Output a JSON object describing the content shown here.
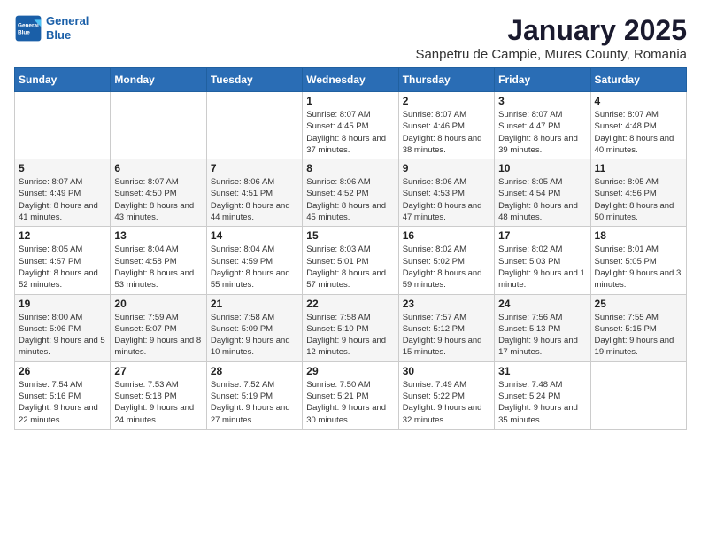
{
  "header": {
    "logo_line1": "General",
    "logo_line2": "Blue",
    "month": "January 2025",
    "location": "Sanpetru de Campie, Mures County, Romania"
  },
  "days_of_week": [
    "Sunday",
    "Monday",
    "Tuesday",
    "Wednesday",
    "Thursday",
    "Friday",
    "Saturday"
  ],
  "weeks": [
    [
      {
        "day": "",
        "info": ""
      },
      {
        "day": "",
        "info": ""
      },
      {
        "day": "",
        "info": ""
      },
      {
        "day": "1",
        "info": "Sunrise: 8:07 AM\nSunset: 4:45 PM\nDaylight: 8 hours and 37 minutes."
      },
      {
        "day": "2",
        "info": "Sunrise: 8:07 AM\nSunset: 4:46 PM\nDaylight: 8 hours and 38 minutes."
      },
      {
        "day": "3",
        "info": "Sunrise: 8:07 AM\nSunset: 4:47 PM\nDaylight: 8 hours and 39 minutes."
      },
      {
        "day": "4",
        "info": "Sunrise: 8:07 AM\nSunset: 4:48 PM\nDaylight: 8 hours and 40 minutes."
      }
    ],
    [
      {
        "day": "5",
        "info": "Sunrise: 8:07 AM\nSunset: 4:49 PM\nDaylight: 8 hours and 41 minutes."
      },
      {
        "day": "6",
        "info": "Sunrise: 8:07 AM\nSunset: 4:50 PM\nDaylight: 8 hours and 43 minutes."
      },
      {
        "day": "7",
        "info": "Sunrise: 8:06 AM\nSunset: 4:51 PM\nDaylight: 8 hours and 44 minutes."
      },
      {
        "day": "8",
        "info": "Sunrise: 8:06 AM\nSunset: 4:52 PM\nDaylight: 8 hours and 45 minutes."
      },
      {
        "day": "9",
        "info": "Sunrise: 8:06 AM\nSunset: 4:53 PM\nDaylight: 8 hours and 47 minutes."
      },
      {
        "day": "10",
        "info": "Sunrise: 8:05 AM\nSunset: 4:54 PM\nDaylight: 8 hours and 48 minutes."
      },
      {
        "day": "11",
        "info": "Sunrise: 8:05 AM\nSunset: 4:56 PM\nDaylight: 8 hours and 50 minutes."
      }
    ],
    [
      {
        "day": "12",
        "info": "Sunrise: 8:05 AM\nSunset: 4:57 PM\nDaylight: 8 hours and 52 minutes."
      },
      {
        "day": "13",
        "info": "Sunrise: 8:04 AM\nSunset: 4:58 PM\nDaylight: 8 hours and 53 minutes."
      },
      {
        "day": "14",
        "info": "Sunrise: 8:04 AM\nSunset: 4:59 PM\nDaylight: 8 hours and 55 minutes."
      },
      {
        "day": "15",
        "info": "Sunrise: 8:03 AM\nSunset: 5:01 PM\nDaylight: 8 hours and 57 minutes."
      },
      {
        "day": "16",
        "info": "Sunrise: 8:02 AM\nSunset: 5:02 PM\nDaylight: 8 hours and 59 minutes."
      },
      {
        "day": "17",
        "info": "Sunrise: 8:02 AM\nSunset: 5:03 PM\nDaylight: 9 hours and 1 minute."
      },
      {
        "day": "18",
        "info": "Sunrise: 8:01 AM\nSunset: 5:05 PM\nDaylight: 9 hours and 3 minutes."
      }
    ],
    [
      {
        "day": "19",
        "info": "Sunrise: 8:00 AM\nSunset: 5:06 PM\nDaylight: 9 hours and 5 minutes."
      },
      {
        "day": "20",
        "info": "Sunrise: 7:59 AM\nSunset: 5:07 PM\nDaylight: 9 hours and 8 minutes."
      },
      {
        "day": "21",
        "info": "Sunrise: 7:58 AM\nSunset: 5:09 PM\nDaylight: 9 hours and 10 minutes."
      },
      {
        "day": "22",
        "info": "Sunrise: 7:58 AM\nSunset: 5:10 PM\nDaylight: 9 hours and 12 minutes."
      },
      {
        "day": "23",
        "info": "Sunrise: 7:57 AM\nSunset: 5:12 PM\nDaylight: 9 hours and 15 minutes."
      },
      {
        "day": "24",
        "info": "Sunrise: 7:56 AM\nSunset: 5:13 PM\nDaylight: 9 hours and 17 minutes."
      },
      {
        "day": "25",
        "info": "Sunrise: 7:55 AM\nSunset: 5:15 PM\nDaylight: 9 hours and 19 minutes."
      }
    ],
    [
      {
        "day": "26",
        "info": "Sunrise: 7:54 AM\nSunset: 5:16 PM\nDaylight: 9 hours and 22 minutes."
      },
      {
        "day": "27",
        "info": "Sunrise: 7:53 AM\nSunset: 5:18 PM\nDaylight: 9 hours and 24 minutes."
      },
      {
        "day": "28",
        "info": "Sunrise: 7:52 AM\nSunset: 5:19 PM\nDaylight: 9 hours and 27 minutes."
      },
      {
        "day": "29",
        "info": "Sunrise: 7:50 AM\nSunset: 5:21 PM\nDaylight: 9 hours and 30 minutes."
      },
      {
        "day": "30",
        "info": "Sunrise: 7:49 AM\nSunset: 5:22 PM\nDaylight: 9 hours and 32 minutes."
      },
      {
        "day": "31",
        "info": "Sunrise: 7:48 AM\nSunset: 5:24 PM\nDaylight: 9 hours and 35 minutes."
      },
      {
        "day": "",
        "info": ""
      }
    ]
  ]
}
